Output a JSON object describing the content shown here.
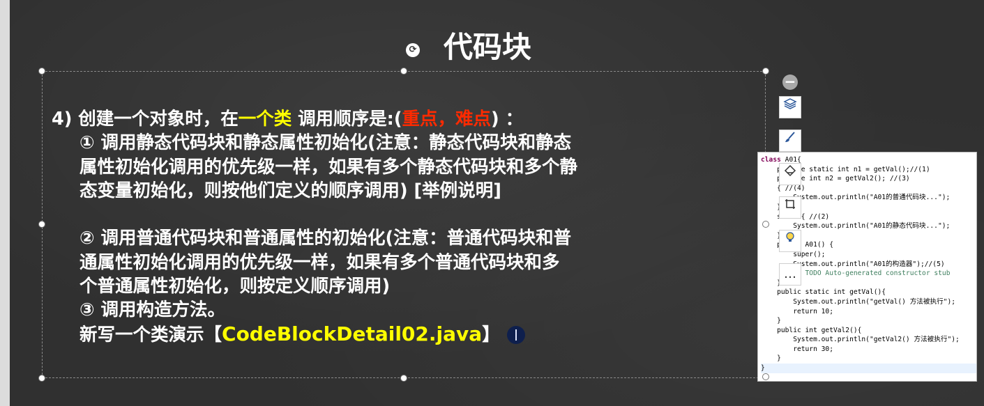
{
  "slide": {
    "title": "代码块",
    "rotate_glyph": "⟳",
    "item4": {
      "prefix": "4) 创建一个对象时，在",
      "highlight": "一个类",
      "middle": " 调用顺序是:(",
      "important": "重点，难点",
      "suffix": ") ："
    },
    "point1": [
      "① 调用静态代码块和静态属性初始化(注意：静态代码块和静态",
      "属性初始化调用的优先级一样，如果有多个静态代码块和多个静",
      "态变量初始化，则按他们定义的顺序调用) [举例说明]"
    ],
    "point2": [
      "② 调用普通代码块和普通属性的初始化(注意：普通代码块和普",
      "通属性初始化调用的优先级一样，如果有多个普通代码块和多",
      "个普通属性初始化，则按定义顺序调用)"
    ],
    "point3": "③ 调用构造方法。",
    "demo": {
      "prefix": "新写一个类演示【",
      "file": "CodeBlockDetail02.java",
      "suffix": "】"
    }
  },
  "toolbar": {
    "collapse_glyph": "−",
    "more_glyph": "…"
  },
  "code": {
    "lines": [
      "class A01{",
      "    private static int n1 = getVal();//(1)",
      "    private int n2 = getVal2(); //(3)",
      "    { //(4)",
      "        System.out.println(\"A01的普通代码块...\");",
      "    }",
      "    static{ //(2)",
      "        System.out.println(\"A01的静态代码块...\");",
      "    }",
      "    public A01() {",
      "        super();",
      "        System.out.println(\"A01的构造器\");//(5)",
      "        // TODO Auto-generated constructor stub",
      "    }",
      "    public static int getVal(){",
      "        System.out.println(\"getVal() 方法被执行\");",
      "        return 10;",
      "    }",
      "    public int getVal2(){",
      "        System.out.println(\"getVal2() 方法被执行\");",
      "        return 30;",
      "    }",
      "}"
    ]
  },
  "colors": {
    "highlight": "#ffff00",
    "important": "#ff2a00",
    "background": "#303030"
  }
}
